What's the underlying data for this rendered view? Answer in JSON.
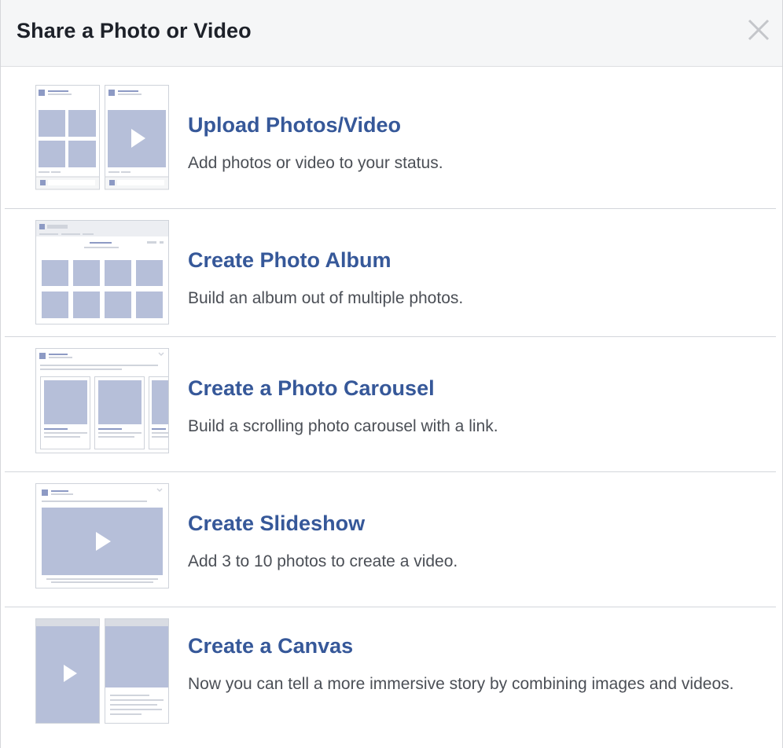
{
  "dialog": {
    "title": "Share a Photo or Video",
    "close_icon": "close-icon"
  },
  "options": [
    {
      "label": "Upload Photos/Video",
      "description": "Add photos or video to your status."
    },
    {
      "label": "Create Photo Album",
      "description": "Build an album out of multiple photos."
    },
    {
      "label": "Create a Photo Carousel",
      "description": "Build a scrolling photo carousel with a link."
    },
    {
      "label": "Create Slideshow",
      "description": "Add 3 to 10 photos to create a video."
    },
    {
      "label": "Create a Canvas",
      "description": "Now you can tell a more immersive story by combining images and videos."
    }
  ],
  "colors": {
    "link": "#365899",
    "thumb_fill": "#b6bfd9",
    "thumb_dark": "#8d9ac4",
    "header_bg": "#f5f6f7"
  }
}
